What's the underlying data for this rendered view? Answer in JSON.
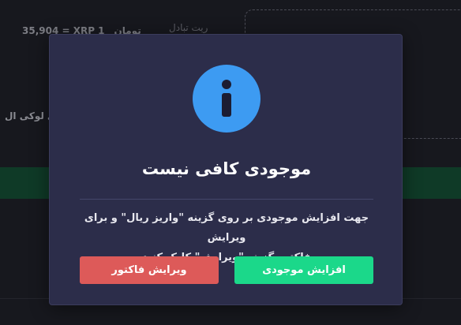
{
  "background": {
    "rate_value": "35,904 = XRP 1",
    "rate_unit": "تومان",
    "rate_label": "ریت تبادل",
    "side_text": "ارزی لوکی ال"
  },
  "modal": {
    "icon": "info-icon",
    "title": "موجودی کافی نیست",
    "message_line1": "جهت افزایش موجودی بر روی گزینه \"واریز ریال\" و برای ویرایش",
    "message_line2": "فاکتور گزینه \"ویرایش\" کلیک کنید",
    "increase_label": "افزایش موجودی",
    "edit_label": "ویرایش فاکتور"
  },
  "colors": {
    "modal_bg": "#2c2d4a",
    "info_blue": "#3d9bf2",
    "success_green": "#1bd88a",
    "danger_red": "#dd5a59"
  }
}
